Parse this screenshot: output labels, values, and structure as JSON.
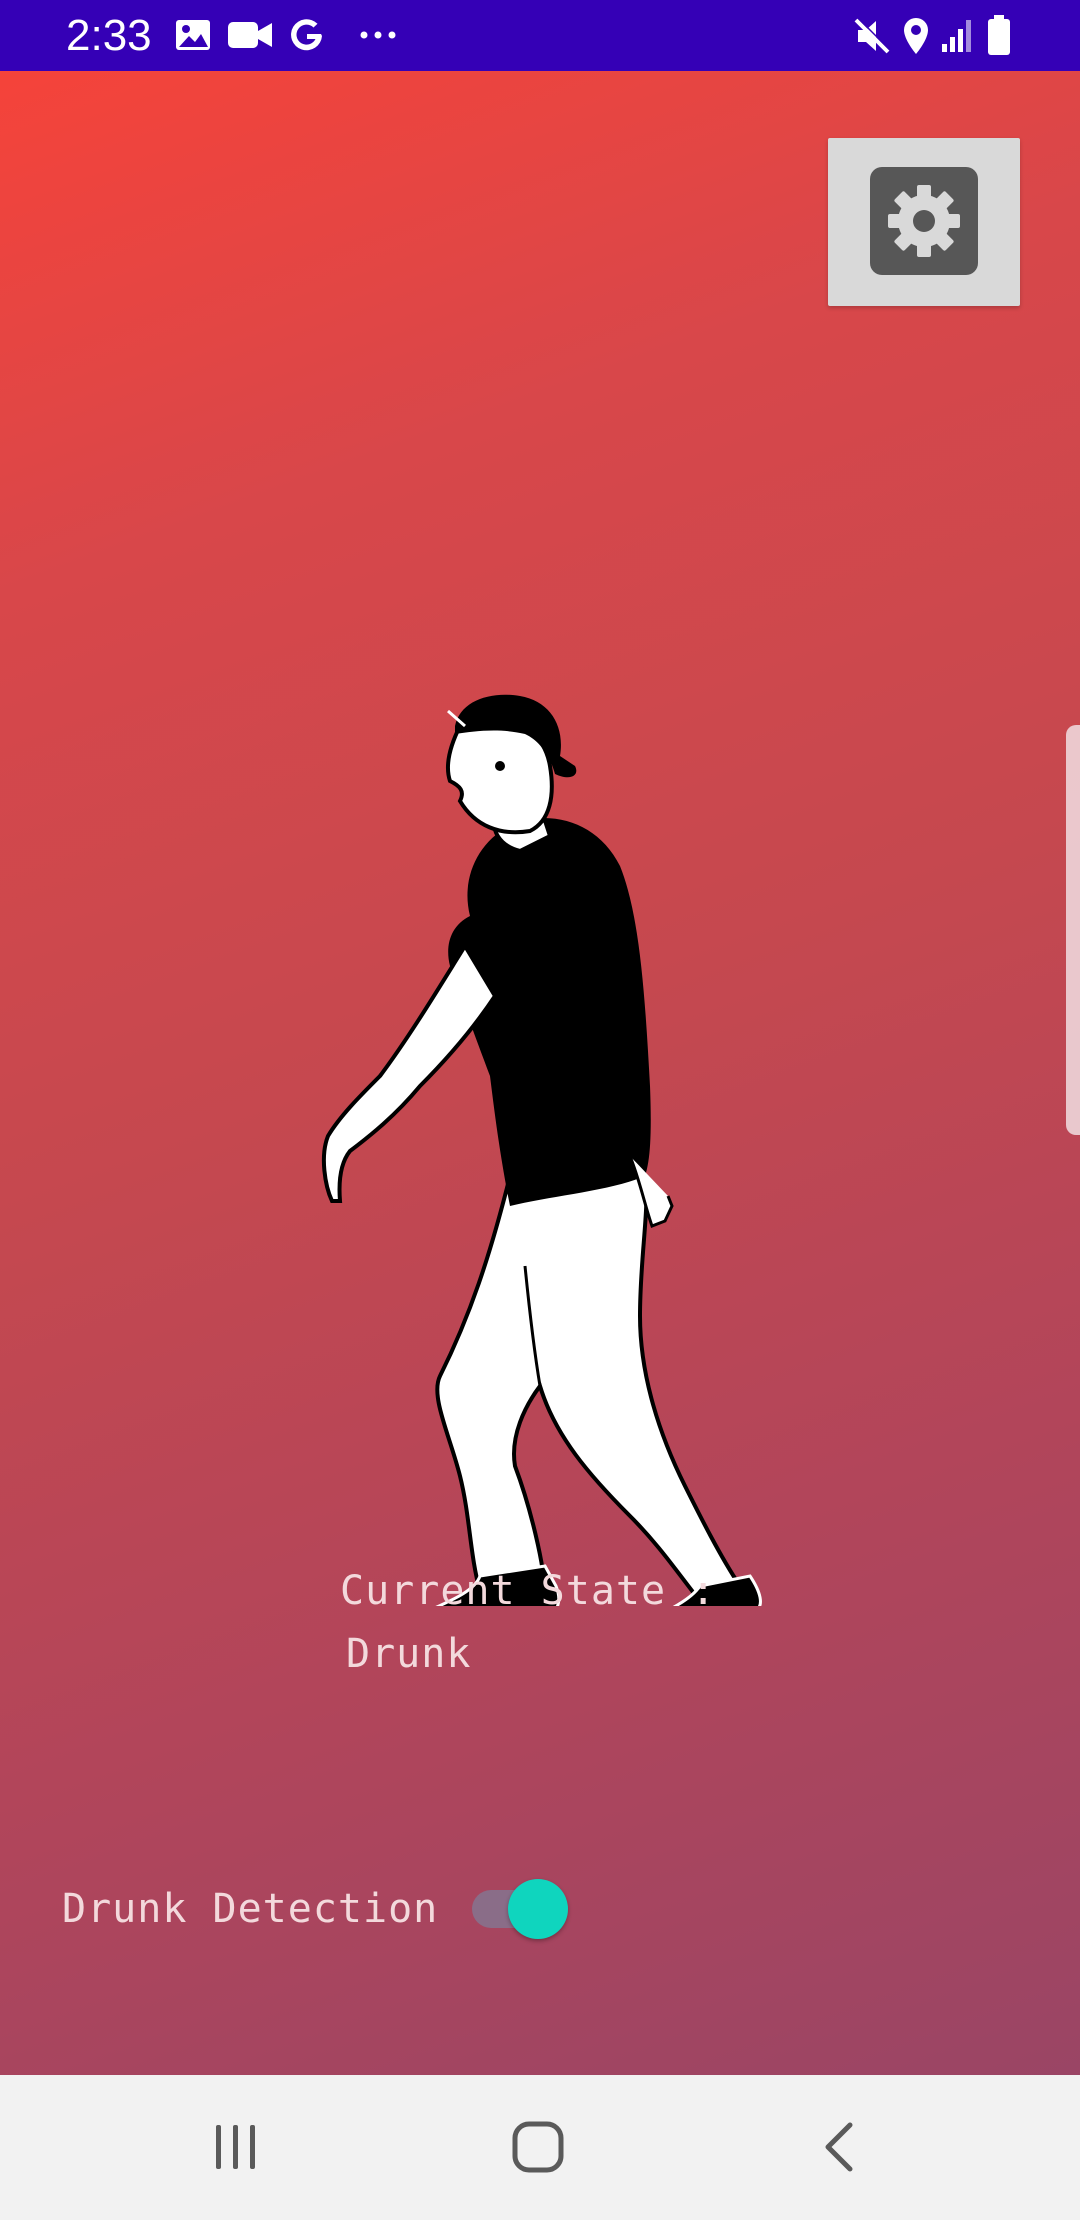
{
  "status_bar": {
    "time": "2:33",
    "left_icons": [
      "image-icon",
      "video-icon",
      "google-icon",
      "more-dots-icon"
    ],
    "right_icons": [
      "mute-icon",
      "location-icon",
      "signal-icon",
      "battery-icon"
    ],
    "background": "#3500b6"
  },
  "toolbar": {
    "settings_icon": "gear-icon"
  },
  "main": {
    "illustration": "walking-person-illustration",
    "state_label": "Current State :",
    "state_value": "Drunk"
  },
  "detection": {
    "label": "Drunk Detection",
    "enabled": true,
    "accent": "#0fd5be"
  },
  "nav_bar": {
    "icons": [
      "recent-apps-icon",
      "home-icon",
      "back-icon"
    ]
  }
}
